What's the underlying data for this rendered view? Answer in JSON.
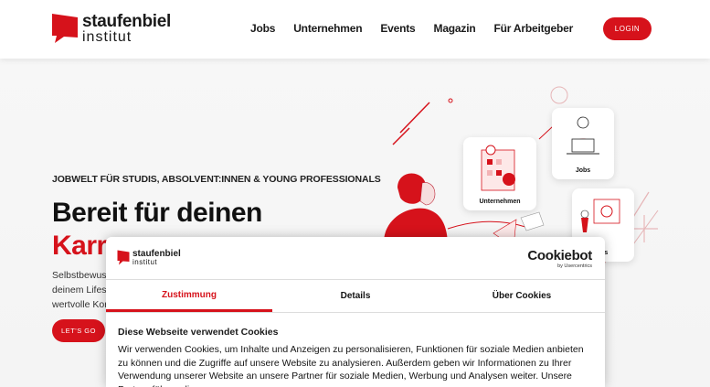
{
  "header": {
    "logo_line1": "staufenbiel",
    "logo_line2": "institut",
    "nav": [
      {
        "label": "Jobs"
      },
      {
        "label": "Unternehmen"
      },
      {
        "label": "Events"
      },
      {
        "label": "Magazin"
      },
      {
        "label": "Für Arbeitgeber"
      }
    ],
    "login_label": "LOGIN"
  },
  "hero": {
    "eyebrow": "JOBWELT FÜR STUDIS, ABSOLVENT:INNEN & YOUNG PROFESSIONALS",
    "headline_line1": "Bereit für deinen",
    "headline_line2": "Karr",
    "desc_line1": "Selbstbewus",
    "desc_line2": "deinem Lifes",
    "desc_line3": "wertvolle Kor",
    "cta_label": "LET'S GO"
  },
  "illustration": {
    "card_jobs": "Jobs",
    "card_unternehmen": "Unternehmen",
    "card_events": "nts"
  },
  "cookie": {
    "logo_line1": "staufenbiel",
    "logo_line2": "institut",
    "cookiebot_title": "Cookiebot",
    "cookiebot_sub": "by Usercentrics",
    "tabs": [
      {
        "label": "Zustimmung"
      },
      {
        "label": "Details"
      },
      {
        "label": "Über Cookies"
      }
    ],
    "heading": "Diese Webseite verwendet Cookies",
    "body": "Wir verwenden Cookies, um Inhalte und Anzeigen zu personalisieren, Funktionen für soziale Medien anbieten zu können und die Zugriffe auf unsere Website zu analysieren. Außerdem geben wir Informationen zu Ihrer Verwendung unserer Website an unsere Partner für soziale Medien, Werbung und Analysen weiter. Unsere Partner führen diese"
  },
  "colors": {
    "brand_red": "#d6121b"
  }
}
